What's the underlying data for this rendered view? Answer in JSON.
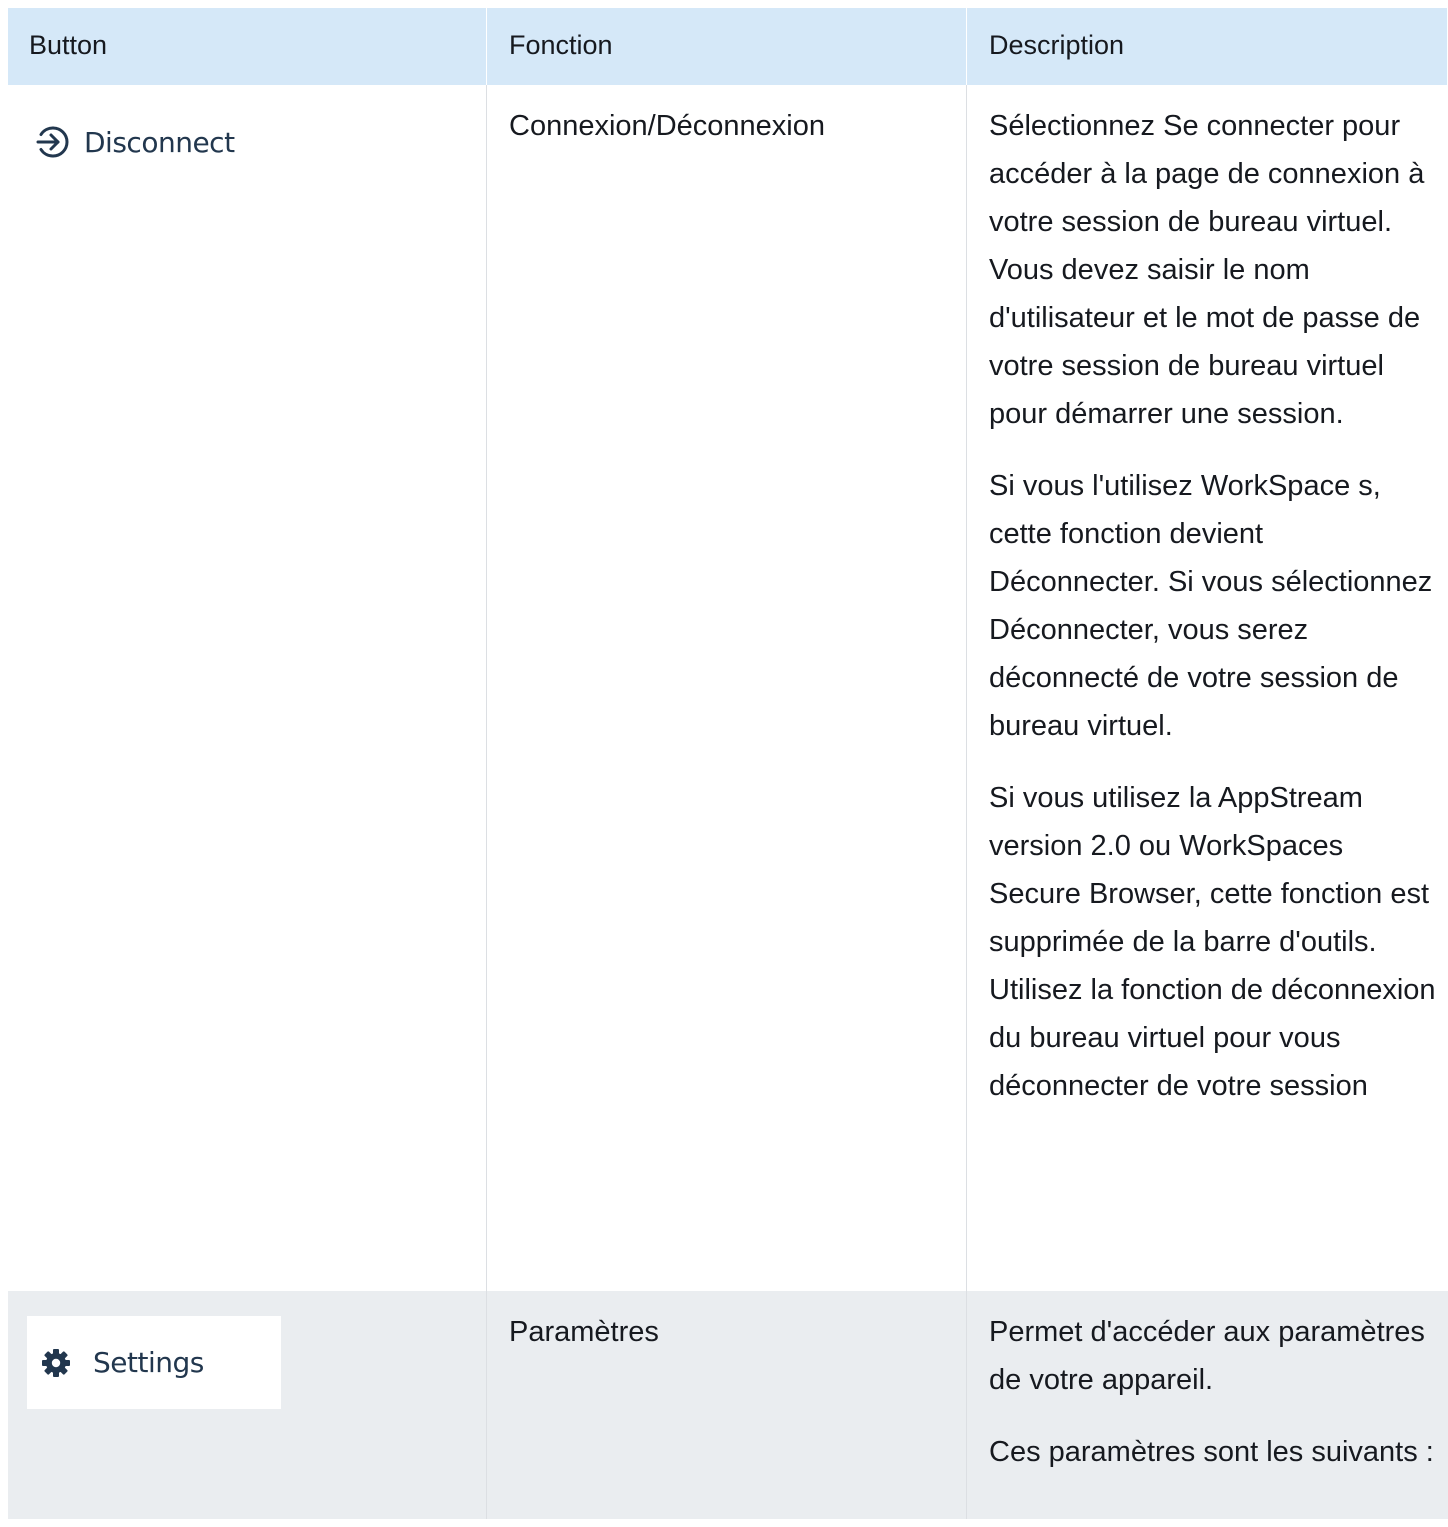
{
  "table": {
    "headers": {
      "button": "Button",
      "function": "Fonction",
      "description": "Description"
    },
    "rows": [
      {
        "button_label": "Disconnect",
        "button_icon": "sign-in-arrow-icon",
        "function": "Connexion/Déconnexion",
        "description": [
          "Sélectionnez Se connecter pour accéder à la page de connexion à votre session de bureau virtuel. Vous devez saisir le nom d'utilisateur et le mot de passe de votre session de bureau virtuel pour démarrer une session.",
          "Si vous l'utilisez WorkSpace s, cette fonction devient Déconnecter. Si vous sélectionnez Déconnecter, vous serez déconnecté de votre session de bureau virtuel.",
          "Si vous utilisez la AppStream version 2.0 ou WorkSpaces Secure Browser, cette fonction est supprimée de la barre d'outils. Utilisez la fonction de déconnexion du bureau virtuel pour vous déconnecter de votre session"
        ]
      },
      {
        "button_label": "Settings",
        "button_icon": "gear-icon",
        "function": "Paramètres",
        "description": [
          "Permet d'accéder aux paramètres de votre appareil.",
          "Ces paramètres sont les suivants :"
        ]
      }
    ]
  },
  "colors": {
    "header_bg": "#d5e8f8",
    "row_alt_bg": "#eaedf0",
    "icon_color": "#22374e"
  }
}
